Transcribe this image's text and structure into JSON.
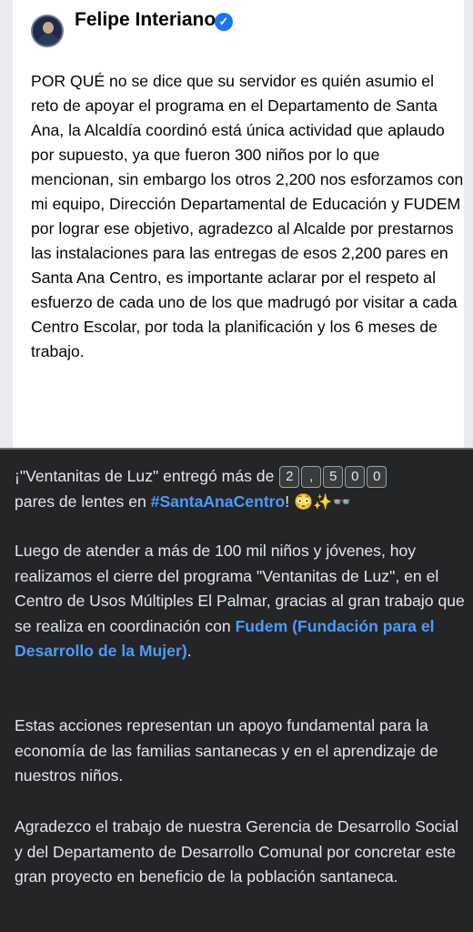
{
  "top_post": {
    "author": "Felipe Interiano",
    "verified_symbol": "✓",
    "body": "POR QUÉ no se dice que su servidor es quién asumio el reto de apoyar el programa en el Departamento de Santa Ana, la Alcaldía coordinó está única actividad que aplaudo por supuesto, ya que fueron 300 niños por lo que mencionan, sin embargo los otros 2,200 nos esforzamos con mi equipo, Dirección Departamental de Educación y FUDEM por lograr ese objetivo, agradezco al Alcalde por prestarnos las instalaciones para las entregas de esos 2,200 pares en Santa Ana Centro, es importante aclarar por el respeto al esfuerzo de cada uno de los que madrugó por visitar a cada Centro Escolar, por toda la planificación y los 6 meses de trabajo."
  },
  "bottom_post": {
    "p1_start": "¡\"Ventanitas de Luz\" entregó más de ",
    "keycaps": [
      "2",
      ",",
      "5",
      "0",
      "0"
    ],
    "p1_mid": "pares de lentes en ",
    "hashtag": "#SantaAnaCentro",
    "p1_end": "! ",
    "emojis": "😳✨👓",
    "p2_start": "Luego de atender a más de 100 mil niños y jóvenes, hoy realizamos el cierre del programa \"Ventanitas de Luz\", en el Centro de Usos Múltiples El Palmar, gracias al gran trabajo que se realiza en coordinación con ",
    "mention": "Fudem (Fundación para el Desarrollo de la Mujer)",
    "p2_end": ".",
    "p3": "Estas acciones representan un apoyo fundamental para la economía de las familias santanecas y en el aprendizaje de nuestros niños.",
    "p4": "Agradezco el trabajo de nuestra Gerencia de Desarrollo Social y del Departamento de Desarrollo Comunal por concretar este gran proyecto en beneficio de la población santaneca."
  },
  "colors": {
    "link": "#4d9aff",
    "dark_background": "#242526",
    "verified_badge": "#1877f2"
  }
}
